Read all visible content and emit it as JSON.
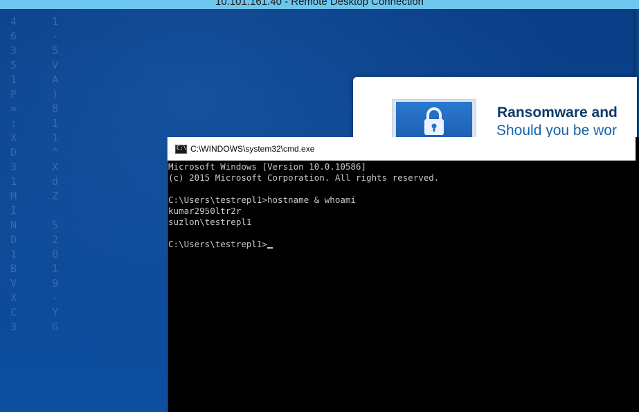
{
  "rdp": {
    "title": "10.101.161.40 - Remote Desktop Connection"
  },
  "popup": {
    "title": "Ransomware and",
    "subtitle": "Should you be wor"
  },
  "cmd": {
    "title": "C:\\WINDOWS\\system32\\cmd.exe",
    "icon_label": "C:\\",
    "lines": [
      "Microsoft Windows [Version 10.0.10586]",
      "(c) 2015 Microsoft Corporation. All rights reserved.",
      "",
      "C:\\Users\\testrepl1>hostname & whoami",
      "kumar2950ltr2r",
      "suzlon\\testrepl1",
      "",
      "C:\\Users\\testrepl1>"
    ]
  },
  "colors": {
    "rdp_bar": "#6cc6ee",
    "desktop_bg": "#0b3f86",
    "console_bg": "#000000",
    "console_text": "#c8c8c8"
  }
}
